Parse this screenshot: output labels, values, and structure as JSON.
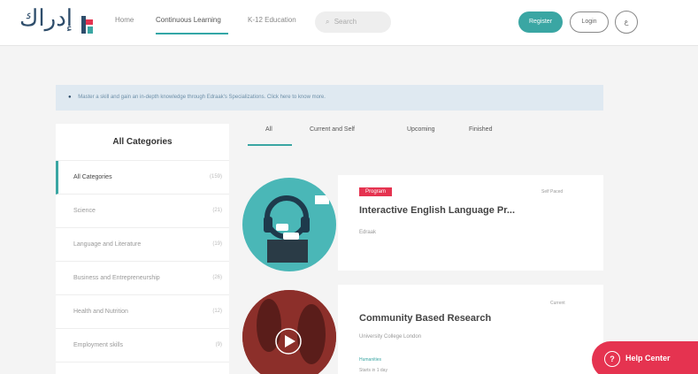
{
  "header": {
    "logo_text": "إدراك",
    "nav": [
      "Home",
      "Continuous Learning",
      "K-12 Education"
    ],
    "search_placeholder": "Search",
    "register": "Register",
    "login": "Login",
    "lang": "ع"
  },
  "banner": {
    "text": "Master a skill and gain an in-depth knowledge through Edraak's Specializations. Click here to know more."
  },
  "sidebar": {
    "title": "All Categories",
    "items": [
      {
        "label": "All Categories",
        "count": "(159)"
      },
      {
        "label": "Science",
        "count": "(21)"
      },
      {
        "label": "Language and Literature",
        "count": "(19)"
      },
      {
        "label": "Business and Entrepreneurship",
        "count": "(26)"
      },
      {
        "label": "Health and Nutrition",
        "count": "(12)"
      },
      {
        "label": "Employment skills",
        "count": "(9)"
      }
    ]
  },
  "tabs": [
    "All",
    "Current and Self",
    "Upcoming",
    "Finished"
  ],
  "courses": [
    {
      "badge": "Program",
      "title": "Interactive English Language Pr...",
      "provider": "Edraak",
      "pace": "Self Paced"
    },
    {
      "title": "Community Based Research",
      "provider": "University College London",
      "pace": "Current",
      "link": "Humanities",
      "extra": "Starts in 1 day"
    }
  ],
  "help": {
    "label": "Help Center"
  },
  "colors": {
    "accent": "#3aa6a3",
    "badge": "#e53350",
    "help": "#e53350",
    "banner_bg": "#dfe9f1"
  }
}
